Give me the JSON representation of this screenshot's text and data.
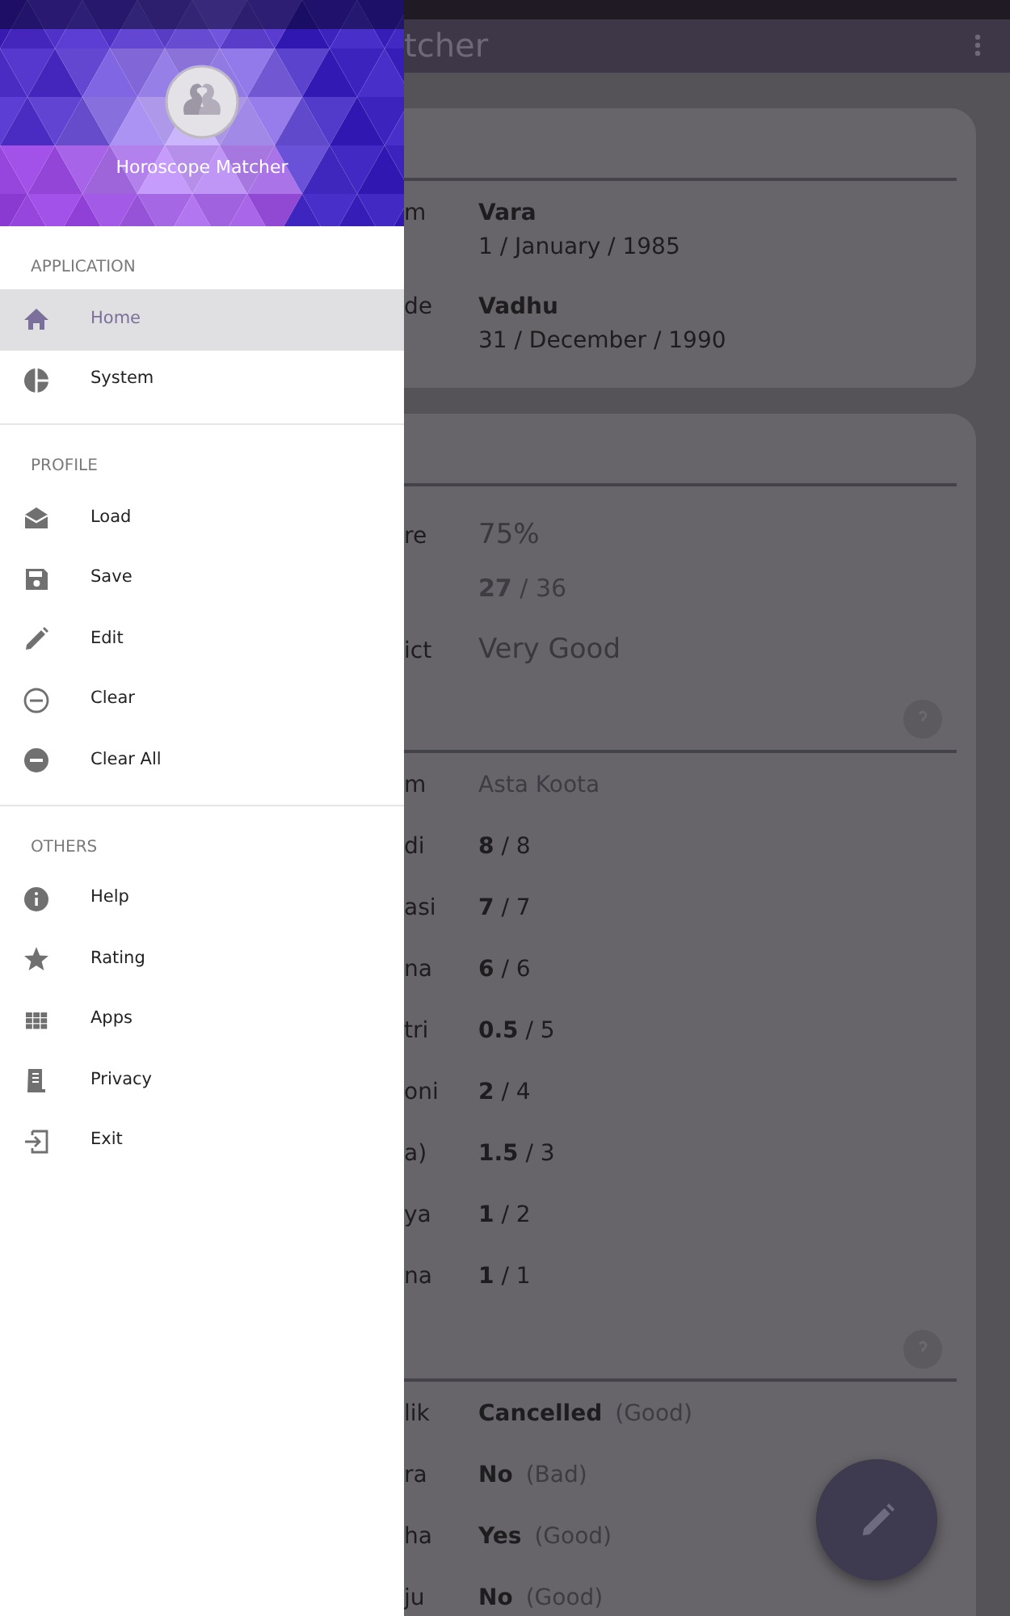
{
  "drawer": {
    "title": "Horoscope Matcher",
    "sections": [
      {
        "heading": "APPLICATION",
        "items": [
          {
            "label": "Home",
            "kind": "home",
            "selected": true
          },
          {
            "label": "System",
            "kind": "pie",
            "selected": false
          }
        ]
      },
      {
        "heading": "PROFILE",
        "items": [
          {
            "label": "Load",
            "kind": "mail",
            "selected": false
          },
          {
            "label": "Save",
            "kind": "save",
            "selected": false
          },
          {
            "label": "Edit",
            "kind": "pencil",
            "selected": false
          },
          {
            "label": "Clear",
            "kind": "minus-outline",
            "selected": false
          },
          {
            "label": "Clear All",
            "kind": "minus-filled",
            "selected": false
          }
        ]
      },
      {
        "heading": "OTHERS",
        "items": [
          {
            "label": "Help",
            "kind": "info",
            "selected": false
          },
          {
            "label": "Rating",
            "kind": "star",
            "selected": false
          },
          {
            "label": "Apps",
            "kind": "grid",
            "selected": false
          },
          {
            "label": "Privacy",
            "kind": "document",
            "selected": false
          },
          {
            "label": "Exit",
            "kind": "exit",
            "selected": false
          }
        ]
      }
    ]
  },
  "app_bar": {
    "title": "tcher"
  },
  "profiles_card": {
    "rows": [
      {
        "label": "m",
        "name": "Vara",
        "date": "1 / January / 1985"
      },
      {
        "label": "de",
        "name": "Vadhu",
        "date": "31 / December / 1990"
      }
    ]
  },
  "result_card": {
    "summary": [
      {
        "label": "re",
        "value": "75%"
      },
      {
        "value": "**27** / 36"
      },
      {
        "label": "ict",
        "value": "Very Good"
      }
    ],
    "koota_header": {
      "label": "m",
      "value": "Asta Koota"
    },
    "kootas": [
      {
        "label": "di",
        "value": "**8** / 8"
      },
      {
        "label": "asi",
        "value": "**7** / 7"
      },
      {
        "label": "na",
        "value": "**6** / 6"
      },
      {
        "label": "tri",
        "value": "**0.5** / 5"
      },
      {
        "label": "oni",
        "value": "**2** / 4"
      },
      {
        "label": "a)",
        "value": "**1.5** / 3"
      },
      {
        "label": "ya",
        "value": "**1** / 2"
      },
      {
        "label": "na",
        "value": "**1** / 1"
      }
    ],
    "doshas": [
      {
        "label": "lik",
        "value": "Cancelled",
        "note": "(Good)"
      },
      {
        "label": "ra",
        "value": "No",
        "note": "(Bad)"
      },
      {
        "label": "ha",
        "value": "Yes",
        "note": "(Good)"
      },
      {
        "label": "ju",
        "value": "No",
        "note": "(Good)"
      }
    ]
  }
}
